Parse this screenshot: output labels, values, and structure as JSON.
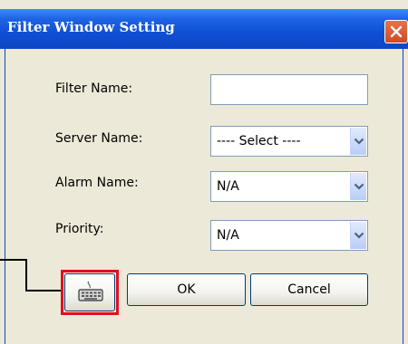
{
  "dialog": {
    "title": "Filter Window Setting",
    "close_icon": "close-x-icon"
  },
  "form": {
    "filter_name": {
      "label": "Filter Name:",
      "value": ""
    },
    "server_name": {
      "label": "Server Name:",
      "value": "---- Select ----"
    },
    "alarm_name": {
      "label": "Alarm Name:",
      "value": "N/A"
    },
    "priority": {
      "label": "Priority:",
      "value": "N/A"
    }
  },
  "buttons": {
    "keyboard_icon": "keyboard-icon",
    "ok_label": "OK",
    "cancel_label": "Cancel"
  },
  "colors": {
    "titlebar": "#0e46c3",
    "close_button": "#d24a22",
    "dialog_bg": "#ece9d8",
    "highlight": "#e0101e"
  }
}
